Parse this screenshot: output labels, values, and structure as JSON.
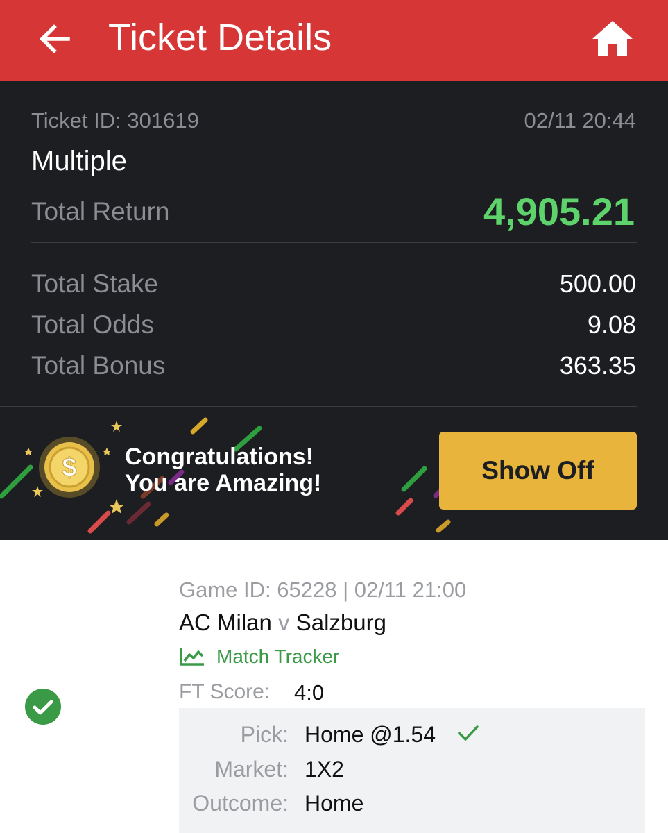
{
  "header": {
    "title": "Ticket Details",
    "back_icon": "arrow-left-icon",
    "home_icon": "home-icon"
  },
  "ticket": {
    "id_text": "Ticket ID: 301619",
    "date": "02/11 20:44",
    "type": "Multiple",
    "return_label": "Total Return",
    "return_value": "4,905.21",
    "stake_label": "Total Stake",
    "stake_value": "500.00",
    "odds_label": "Total Odds",
    "odds_value": "9.08",
    "bonus_label": "Total Bonus",
    "bonus_value": "363.35"
  },
  "congrats": {
    "line1": "Congratulations!",
    "line2": "You are Amazing!",
    "button": "Show Off",
    "icon": "gold-coin-icon"
  },
  "match": {
    "meta": "Game ID: 65228 | 02/11 21:00",
    "home": "AC Milan",
    "vs": "v",
    "away": "Salzburg",
    "tracker_label": "Match Tracker",
    "ft_label": "FT Score:",
    "ft_value": "4:0",
    "pick_label": "Pick:",
    "pick_value": "Home @1.54",
    "market_label": "Market:",
    "market_value": "1X2",
    "outcome_label": "Outcome:",
    "outcome_value": "Home",
    "status_icon": "check-circle-icon"
  },
  "colors": {
    "header_bg": "#d73636",
    "dark_bg": "#1d1e22",
    "win_green": "#5fd36b",
    "button_yellow": "#e8b43c",
    "tracker_green": "#3a9a46"
  }
}
